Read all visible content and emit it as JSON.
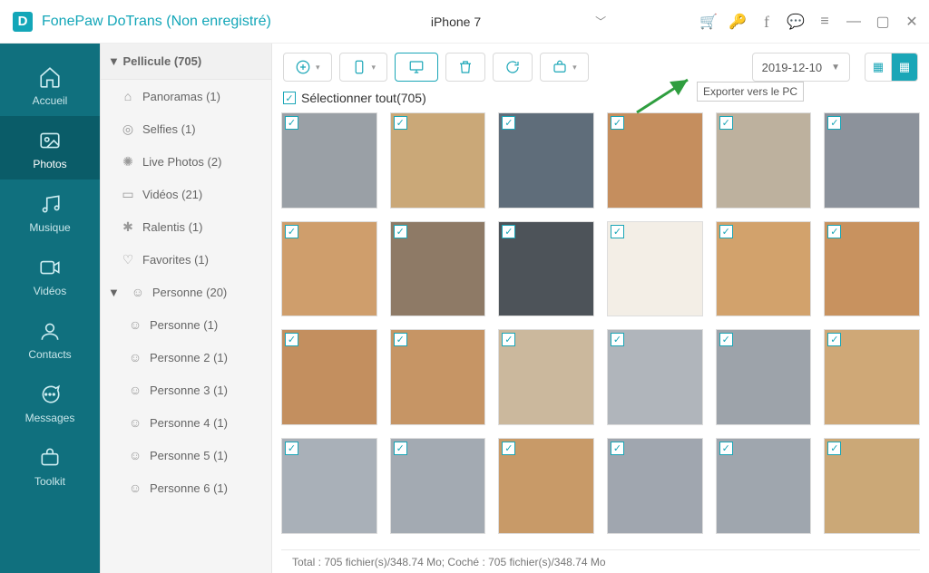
{
  "app": {
    "title": "FonePaw DoTrans (Non enregistré)"
  },
  "device": {
    "name": "iPhone 7"
  },
  "rail": {
    "home": "Accueil",
    "photos": "Photos",
    "music": "Musique",
    "videos": "Vidéos",
    "contacts": "Contacts",
    "messages": "Messages",
    "toolkit": "Toolkit"
  },
  "tree": {
    "root": "Pellicule (705)",
    "panoramas": "Panoramas (1)",
    "selfies": "Selfies (1)",
    "live": "Live Photos (2)",
    "videos": "Vidéos (21)",
    "slowmo": "Ralentis (1)",
    "favorites": "Favorites (1)",
    "people": "Personne (20)",
    "p1": "Personne (1)",
    "p2": "Personne 2 (1)",
    "p3": "Personne 3 (1)",
    "p4": "Personne 4 (1)",
    "p5": "Personne 5 (1)",
    "p6": "Personne 6 (1)"
  },
  "toolbar": {
    "tooltip": "Exporter vers le PC",
    "date": "2019-12-10"
  },
  "selectall": {
    "label": "Sélectionner tout(705)"
  },
  "thumbs": {
    "count": 24,
    "colors": [
      "#9aa0a6",
      "#caa878",
      "#5f6d7a",
      "#c58e5e",
      "#bdb19e",
      "#8c929b",
      "#cf9e6c",
      "#8e7a66",
      "#4d5359",
      "#f3eee6",
      "#d2a26c",
      "#c8925f",
      "#c38f5f",
      "#c69565",
      "#cbb89d",
      "#b0b5bb",
      "#9da3aa",
      "#cfa877",
      "#a9b0b8",
      "#a3aab2",
      "#c89a68",
      "#a0a6af",
      "#9fa6ae",
      "#cba877"
    ]
  },
  "status": {
    "text": "Total : 705 fichier(s)/348.74 Mo; Coché : 705 fichier(s)/348.74 Mo"
  }
}
